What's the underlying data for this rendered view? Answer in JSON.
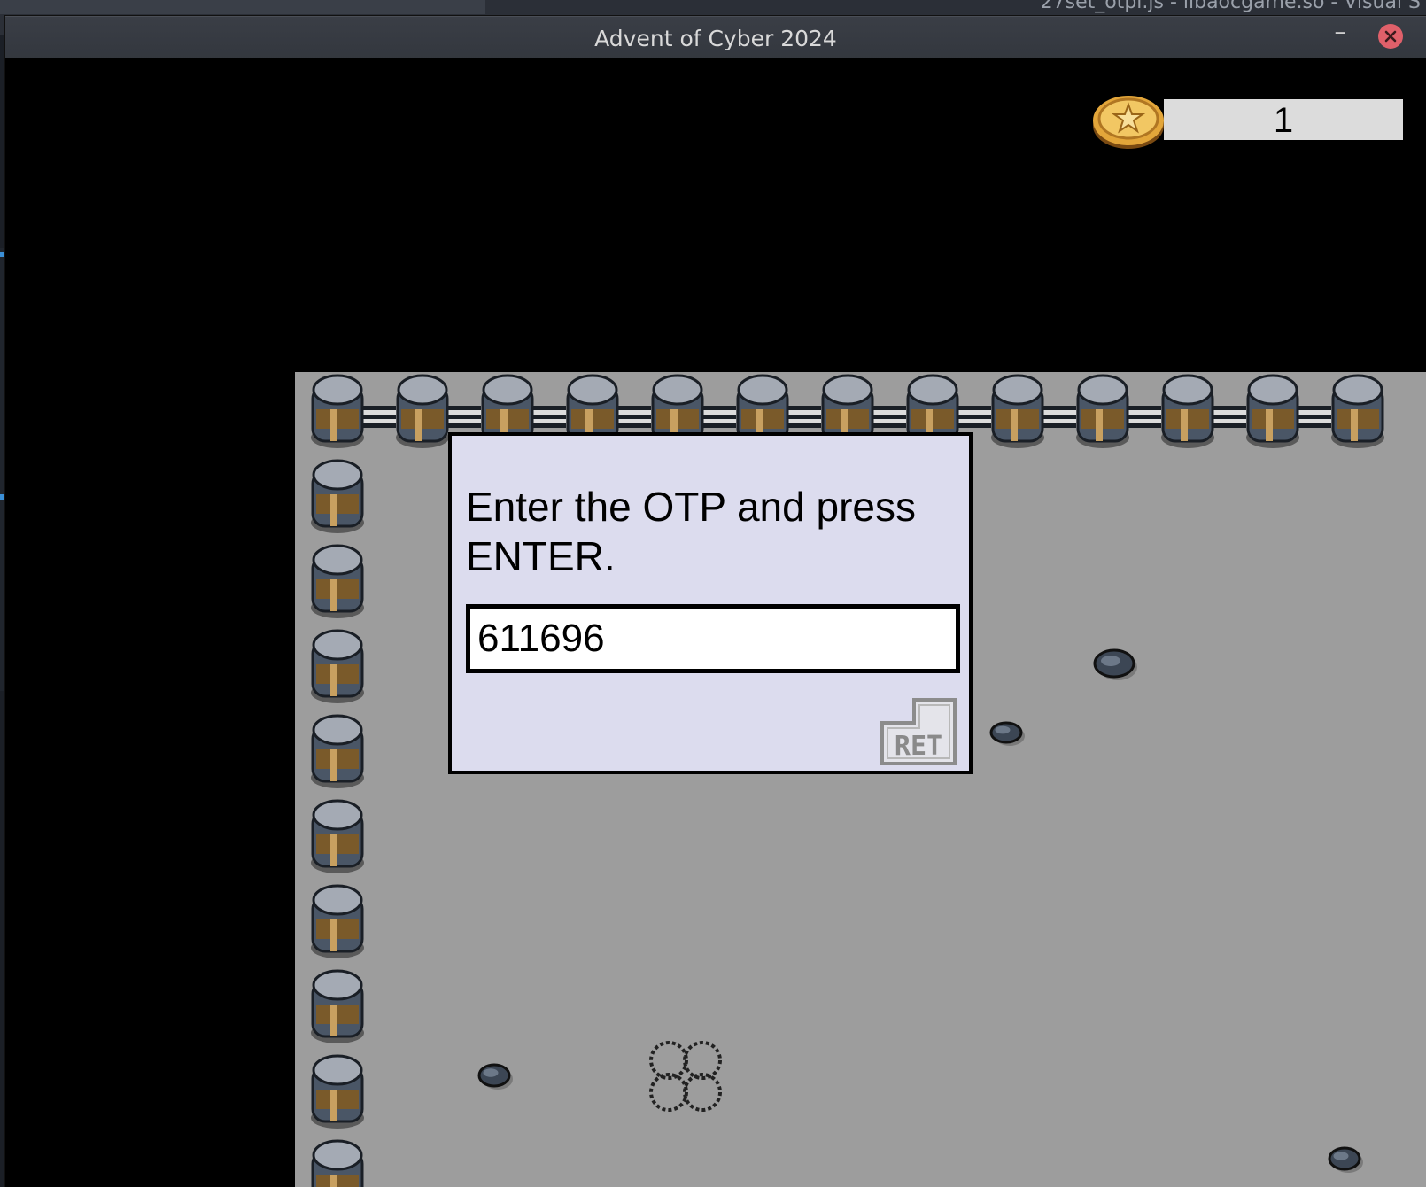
{
  "background_window": {
    "title": "27set_otpl.js - libaocgame.so - Visual S"
  },
  "window": {
    "title": "Advent of Cyber 2024",
    "minimize_label": "–"
  },
  "hud": {
    "coin_count": "1",
    "coin_icon": "gold-coin-icon"
  },
  "dialog": {
    "prompt": "Enter the OTP and press ENTER.",
    "otp_value": "611696",
    "submit_key_label": "RET",
    "submit_icon": "return-key-icon"
  },
  "colors": {
    "dialog_bg": "#dcdcee",
    "floor": "#9d9d9d",
    "close_button": "#e0606a"
  }
}
